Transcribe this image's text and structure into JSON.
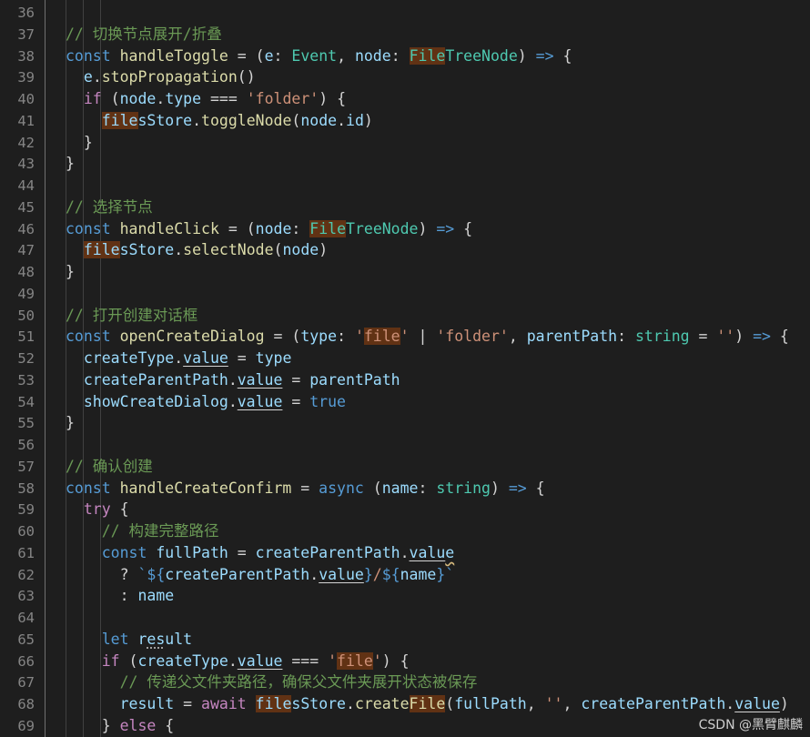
{
  "editor": {
    "lines": [
      {
        "n": "36",
        "tokens": []
      },
      {
        "n": "37",
        "tokens": [
          {
            "t": "// 切换节点展开/折叠",
            "c": "c"
          }
        ]
      },
      {
        "n": "38",
        "tokens": [
          {
            "t": "const ",
            "c": "k"
          },
          {
            "t": "handleToggle",
            "c": "f"
          },
          {
            "t": " = (",
            "c": "p"
          },
          {
            "t": "e",
            "c": "v"
          },
          {
            "t": ": ",
            "c": "p"
          },
          {
            "t": "Event",
            "c": "t"
          },
          {
            "t": ", ",
            "c": "p"
          },
          {
            "t": "node",
            "c": "v"
          },
          {
            "t": ": ",
            "c": "p"
          },
          {
            "t": "File",
            "c": "t",
            "hl": true
          },
          {
            "t": "TreeNode",
            "c": "t"
          },
          {
            "t": ") ",
            "c": "p"
          },
          {
            "t": "=>",
            "c": "k"
          },
          {
            "t": " {",
            "c": "p"
          }
        ]
      },
      {
        "n": "39",
        "tokens": [
          {
            "t": "  e",
            "c": "v"
          },
          {
            "t": ".",
            "c": "p"
          },
          {
            "t": "stopPropagation",
            "c": "f"
          },
          {
            "t": "()",
            "c": "p"
          }
        ]
      },
      {
        "n": "40",
        "tokens": [
          {
            "t": "  if",
            "c": "kc"
          },
          {
            "t": " (",
            "c": "p"
          },
          {
            "t": "node",
            "c": "v"
          },
          {
            "t": ".",
            "c": "p"
          },
          {
            "t": "type",
            "c": "v"
          },
          {
            "t": " === ",
            "c": "p"
          },
          {
            "t": "'folder'",
            "c": "s"
          },
          {
            "t": ") {",
            "c": "p"
          }
        ]
      },
      {
        "n": "41",
        "tokens": [
          {
            "t": "    ",
            "c": "p"
          },
          {
            "t": "file",
            "c": "v",
            "hl": true
          },
          {
            "t": "sStore",
            "c": "v"
          },
          {
            "t": ".",
            "c": "p"
          },
          {
            "t": "toggleNode",
            "c": "f"
          },
          {
            "t": "(",
            "c": "p"
          },
          {
            "t": "node",
            "c": "v"
          },
          {
            "t": ".",
            "c": "p"
          },
          {
            "t": "id",
            "c": "v"
          },
          {
            "t": ")",
            "c": "p"
          }
        ]
      },
      {
        "n": "42",
        "tokens": [
          {
            "t": "  }",
            "c": "p"
          }
        ]
      },
      {
        "n": "43",
        "tokens": [
          {
            "t": "}",
            "c": "p"
          }
        ]
      },
      {
        "n": "44",
        "tokens": []
      },
      {
        "n": "45",
        "tokens": [
          {
            "t": "// 选择节点",
            "c": "c"
          }
        ]
      },
      {
        "n": "46",
        "tokens": [
          {
            "t": "const ",
            "c": "k"
          },
          {
            "t": "handleClick",
            "c": "f"
          },
          {
            "t": " = (",
            "c": "p"
          },
          {
            "t": "node",
            "c": "v"
          },
          {
            "t": ": ",
            "c": "p"
          },
          {
            "t": "File",
            "c": "t",
            "hl": true
          },
          {
            "t": "TreeNode",
            "c": "t"
          },
          {
            "t": ") ",
            "c": "p"
          },
          {
            "t": "=>",
            "c": "k"
          },
          {
            "t": " {",
            "c": "p"
          }
        ]
      },
      {
        "n": "47",
        "tokens": [
          {
            "t": "  ",
            "c": "p"
          },
          {
            "t": "file",
            "c": "v",
            "hl": true
          },
          {
            "t": "sStore",
            "c": "v"
          },
          {
            "t": ".",
            "c": "p"
          },
          {
            "t": "selectNode",
            "c": "f"
          },
          {
            "t": "(",
            "c": "p"
          },
          {
            "t": "node",
            "c": "v"
          },
          {
            "t": ")",
            "c": "p"
          }
        ]
      },
      {
        "n": "48",
        "tokens": [
          {
            "t": "}",
            "c": "p"
          }
        ]
      },
      {
        "n": "49",
        "tokens": []
      },
      {
        "n": "50",
        "tokens": [
          {
            "t": "// 打开创建对话框",
            "c": "c"
          }
        ]
      },
      {
        "n": "51",
        "tokens": [
          {
            "t": "const ",
            "c": "k"
          },
          {
            "t": "openCreateDialog",
            "c": "f"
          },
          {
            "t": " = (",
            "c": "p"
          },
          {
            "t": "type",
            "c": "v"
          },
          {
            "t": ": ",
            "c": "p"
          },
          {
            "t": "'",
            "c": "s"
          },
          {
            "t": "file",
            "c": "s",
            "hl": true
          },
          {
            "t": "'",
            "c": "s"
          },
          {
            "t": " | ",
            "c": "p"
          },
          {
            "t": "'folder'",
            "c": "s"
          },
          {
            "t": ", ",
            "c": "p"
          },
          {
            "t": "parentPath",
            "c": "v"
          },
          {
            "t": ": ",
            "c": "p"
          },
          {
            "t": "string",
            "c": "t"
          },
          {
            "t": " = ",
            "c": "p"
          },
          {
            "t": "''",
            "c": "s"
          },
          {
            "t": ") ",
            "c": "p"
          },
          {
            "t": "=>",
            "c": "k"
          },
          {
            "t": " {",
            "c": "p"
          }
        ]
      },
      {
        "n": "52",
        "tokens": [
          {
            "t": "  createType",
            "c": "v"
          },
          {
            "t": ".",
            "c": "p"
          },
          {
            "t": "value",
            "c": "v",
            "u": true
          },
          {
            "t": " = ",
            "c": "p"
          },
          {
            "t": "type",
            "c": "v"
          }
        ]
      },
      {
        "n": "53",
        "tokens": [
          {
            "t": "  createParentPath",
            "c": "v"
          },
          {
            "t": ".",
            "c": "p"
          },
          {
            "t": "value",
            "c": "v",
            "u": true
          },
          {
            "t": " = ",
            "c": "p"
          },
          {
            "t": "parentPath",
            "c": "v"
          }
        ]
      },
      {
        "n": "54",
        "tokens": [
          {
            "t": "  showCreateDialog",
            "c": "v"
          },
          {
            "t": ".",
            "c": "p"
          },
          {
            "t": "value",
            "c": "v",
            "u": true
          },
          {
            "t": " = ",
            "c": "p"
          },
          {
            "t": "true",
            "c": "k"
          }
        ]
      },
      {
        "n": "55",
        "tokens": [
          {
            "t": "}",
            "c": "p"
          }
        ]
      },
      {
        "n": "56",
        "tokens": []
      },
      {
        "n": "57",
        "tokens": [
          {
            "t": "// 确认创建",
            "c": "c"
          }
        ]
      },
      {
        "n": "58",
        "tokens": [
          {
            "t": "const ",
            "c": "k"
          },
          {
            "t": "handleCreateConfirm",
            "c": "f"
          },
          {
            "t": " = ",
            "c": "p"
          },
          {
            "t": "async",
            "c": "k"
          },
          {
            "t": " (",
            "c": "p"
          },
          {
            "t": "name",
            "c": "v"
          },
          {
            "t": ": ",
            "c": "p"
          },
          {
            "t": "string",
            "c": "t"
          },
          {
            "t": ") ",
            "c": "p"
          },
          {
            "t": "=>",
            "c": "k"
          },
          {
            "t": " {",
            "c": "p"
          }
        ]
      },
      {
        "n": "59",
        "tokens": [
          {
            "t": "  try",
            "c": "kc"
          },
          {
            "t": " {",
            "c": "p"
          }
        ]
      },
      {
        "n": "60",
        "tokens": [
          {
            "t": "    // 构建完整路径",
            "c": "c"
          }
        ]
      },
      {
        "n": "61",
        "tokens": [
          {
            "t": "    const ",
            "c": "k"
          },
          {
            "t": "fullPath",
            "c": "v"
          },
          {
            "t": " = ",
            "c": "p"
          },
          {
            "t": "createParentPath",
            "c": "v"
          },
          {
            "t": ".",
            "c": "p"
          },
          {
            "t": "valu",
            "c": "v",
            "u": true
          },
          {
            "t": "e",
            "c": "v",
            "u": true,
            "sq": true
          }
        ]
      },
      {
        "n": "62",
        "tokens": [
          {
            "t": "      ? ",
            "c": "p"
          },
          {
            "t": "`${",
            "c": "k"
          },
          {
            "t": "createParentPath",
            "c": "v"
          },
          {
            "t": ".",
            "c": "p"
          },
          {
            "t": "value",
            "c": "v",
            "u": true
          },
          {
            "t": "}",
            "c": "k"
          },
          {
            "t": "/",
            "c": "s"
          },
          {
            "t": "${",
            "c": "k"
          },
          {
            "t": "name",
            "c": "v"
          },
          {
            "t": "}`",
            "c": "k"
          }
        ]
      },
      {
        "n": "63",
        "tokens": [
          {
            "t": "      : ",
            "c": "p"
          },
          {
            "t": "name",
            "c": "v"
          }
        ]
      },
      {
        "n": "64",
        "tokens": []
      },
      {
        "n": "65",
        "tokens": [
          {
            "t": "    let ",
            "c": "k"
          },
          {
            "t": "r",
            "c": "v"
          },
          {
            "t": "es",
            "c": "v",
            "dots": true
          },
          {
            "t": "ult",
            "c": "v"
          }
        ]
      },
      {
        "n": "66",
        "tokens": [
          {
            "t": "    if",
            "c": "kc"
          },
          {
            "t": " (",
            "c": "p"
          },
          {
            "t": "createType",
            "c": "v"
          },
          {
            "t": ".",
            "c": "p"
          },
          {
            "t": "value",
            "c": "v",
            "u": true
          },
          {
            "t": " === ",
            "c": "p"
          },
          {
            "t": "'",
            "c": "s"
          },
          {
            "t": "file",
            "c": "s",
            "hl": true
          },
          {
            "t": "'",
            "c": "s"
          },
          {
            "t": ") {",
            "c": "p"
          }
        ]
      },
      {
        "n": "67",
        "tokens": [
          {
            "t": "      // 传递父文件夹路径，确保父文件夹展开状态被保存",
            "c": "c"
          }
        ]
      },
      {
        "n": "68",
        "tokens": [
          {
            "t": "      result",
            "c": "v"
          },
          {
            "t": " = ",
            "c": "p"
          },
          {
            "t": "await",
            "c": "kc"
          },
          {
            "t": " ",
            "c": "p"
          },
          {
            "t": "file",
            "c": "v",
            "hl": true
          },
          {
            "t": "sStore",
            "c": "v"
          },
          {
            "t": ".",
            "c": "p"
          },
          {
            "t": "create",
            "c": "f"
          },
          {
            "t": "File",
            "c": "f",
            "hl": true
          },
          {
            "t": "(",
            "c": "p"
          },
          {
            "t": "fullPath",
            "c": "v"
          },
          {
            "t": ", ",
            "c": "p"
          },
          {
            "t": "''",
            "c": "s"
          },
          {
            "t": ", ",
            "c": "p"
          },
          {
            "t": "createParentPath",
            "c": "v"
          },
          {
            "t": ".",
            "c": "p"
          },
          {
            "t": "value",
            "c": "v",
            "u": true
          },
          {
            "t": ")",
            "c": "p"
          }
        ]
      },
      {
        "n": "69",
        "tokens": [
          {
            "t": "    } ",
            "c": "p"
          },
          {
            "t": "else",
            "c": "kc"
          },
          {
            "t": " {",
            "c": "p"
          }
        ]
      }
    ]
  },
  "watermark": "CSDN @黑臂麒麟"
}
